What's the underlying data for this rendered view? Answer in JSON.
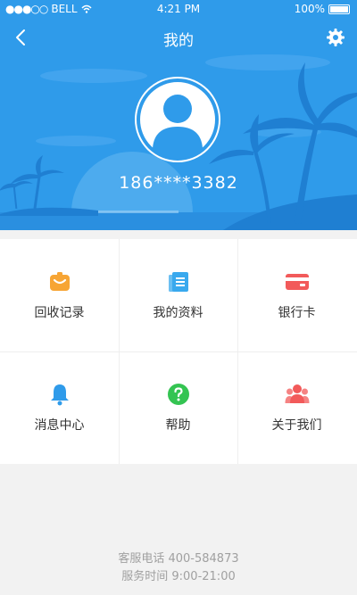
{
  "status_bar": {
    "carrier": "BELL",
    "time": "4:21 PM",
    "battery": "100%"
  },
  "nav": {
    "title": "我的",
    "back_icon": "back-chevron-icon",
    "settings_icon": "gear-icon"
  },
  "profile": {
    "phone": "186****3382",
    "avatar_icon": "user-avatar-icon"
  },
  "menu": [
    {
      "label": "回收记录",
      "icon": "recycle-record-icon",
      "color": "#f7a534"
    },
    {
      "label": "我的资料",
      "icon": "document-icon",
      "color": "#39a9ee"
    },
    {
      "label": "银行卡",
      "icon": "bank-card-icon",
      "color": "#f25a5a"
    },
    {
      "label": "消息中心",
      "icon": "bell-icon",
      "color": "#2f9bea"
    },
    {
      "label": "帮助",
      "icon": "help-icon",
      "color": "#34c452"
    },
    {
      "label": "关于我们",
      "icon": "about-us-icon",
      "color": "#f25a5a"
    }
  ],
  "footer": {
    "hotline": "客服电话 400-584873",
    "hours": "服务时间 9:00-21:00"
  },
  "colors": {
    "header_bg": "#2f9bea",
    "page_bg": "#f2f2f2"
  }
}
